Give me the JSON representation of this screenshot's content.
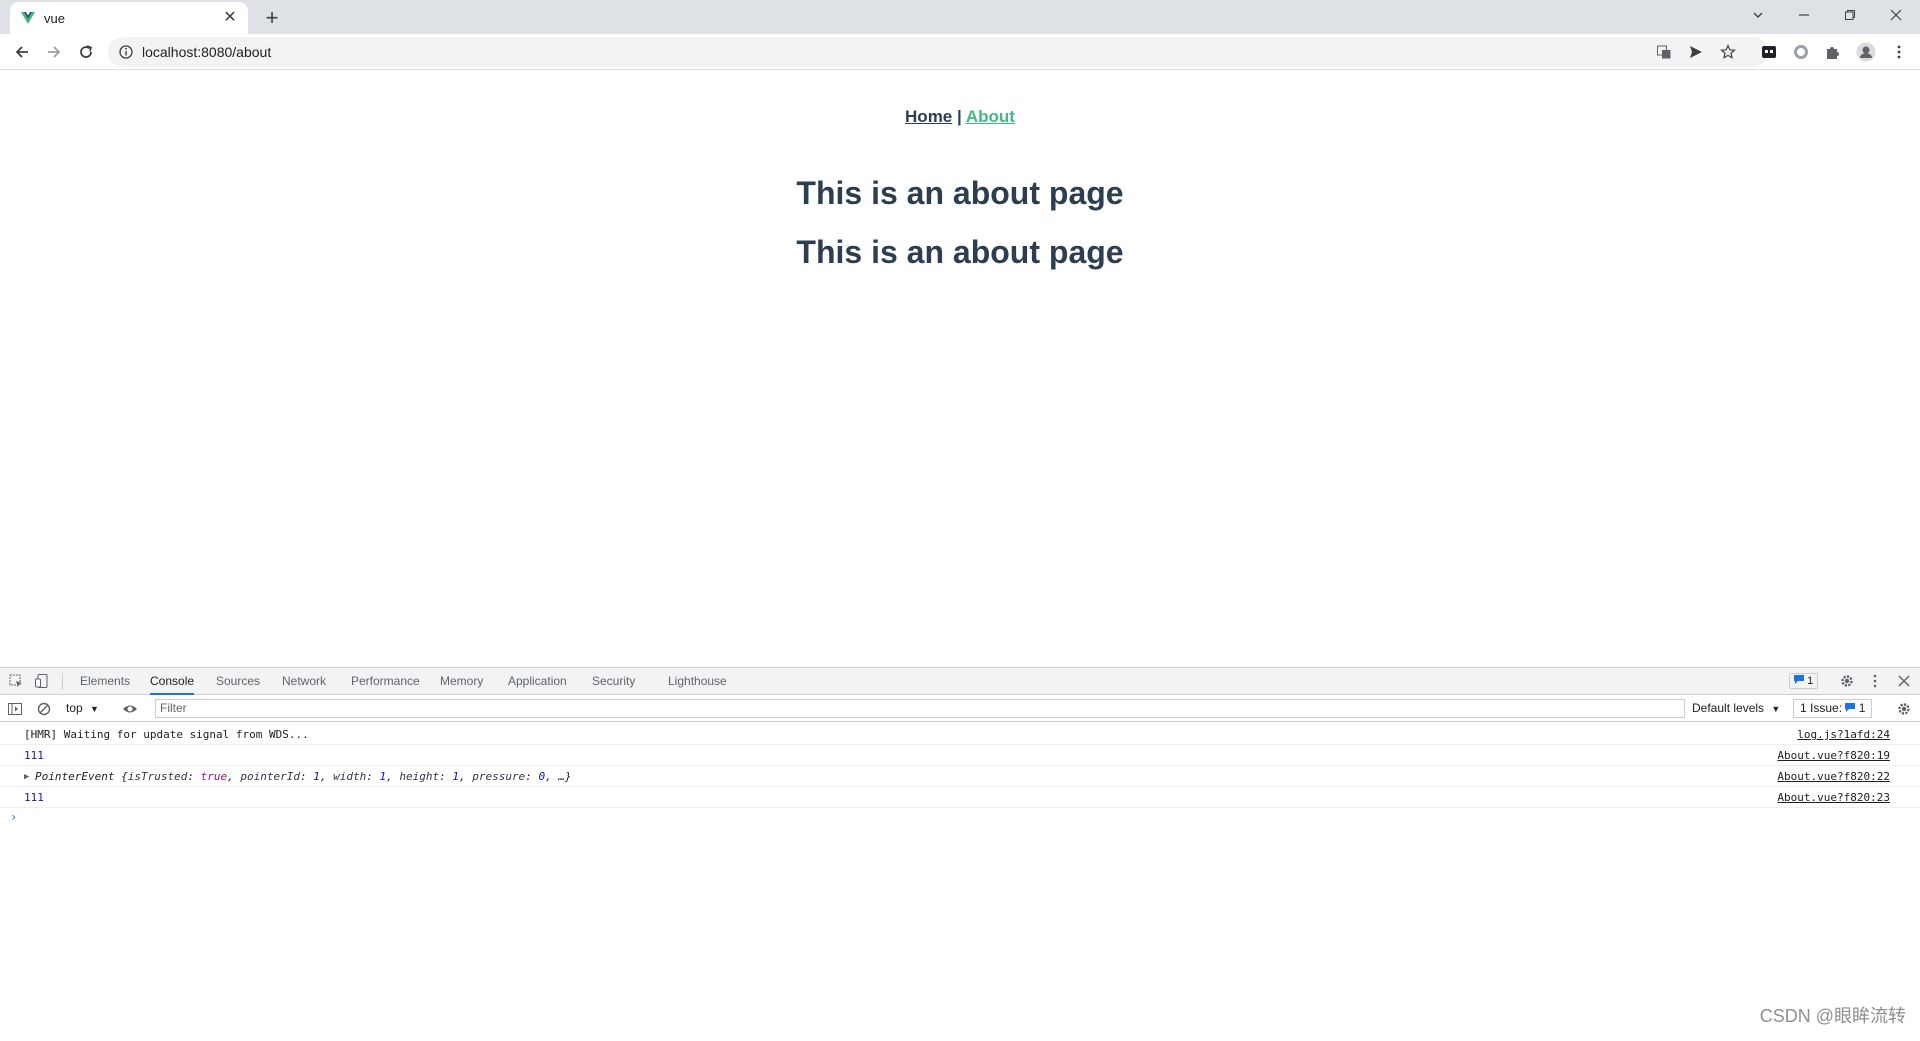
{
  "browser": {
    "tab": {
      "title": "vue"
    },
    "url": "localhost:8080/about",
    "new_tab": "+"
  },
  "page": {
    "nav": {
      "home": "Home",
      "separator": "|",
      "about": "About"
    },
    "headings": [
      "This is an about page",
      "This is an about page"
    ],
    "colors": {
      "text": "#2c3e50",
      "accent": "#42b983"
    }
  },
  "devtools": {
    "tabs": [
      "Elements",
      "Console",
      "Sources",
      "Network",
      "Performance",
      "Memory",
      "Application",
      "Security",
      "Lighthouse"
    ],
    "active_tab": "Console",
    "messages_badge": "1",
    "context": "top",
    "filter_placeholder": "Filter",
    "levels": "Default levels",
    "issues": "1 Issue:",
    "issues_count": "1",
    "logs": [
      {
        "message": "[HMR] Waiting for update signal from WDS...",
        "source": "log.js?1afd:24"
      },
      {
        "message": "111",
        "source": "About.vue?f820:19"
      },
      {
        "message": "PointerEvent {isTrusted: true, pointerId: 1, width: 1, height: 1, pressure: 0, …}",
        "source": "About.vue?f820:22"
      },
      {
        "message": "111",
        "source": "About.vue?f820:23"
      }
    ],
    "pointer_event": {
      "name": "PointerEvent",
      "isTrusted": "true",
      "pointerId": "1",
      "width": "1",
      "height": "1",
      "pressure": "0"
    },
    "prompt": "›"
  },
  "watermark": "CSDN @眼眸流转"
}
